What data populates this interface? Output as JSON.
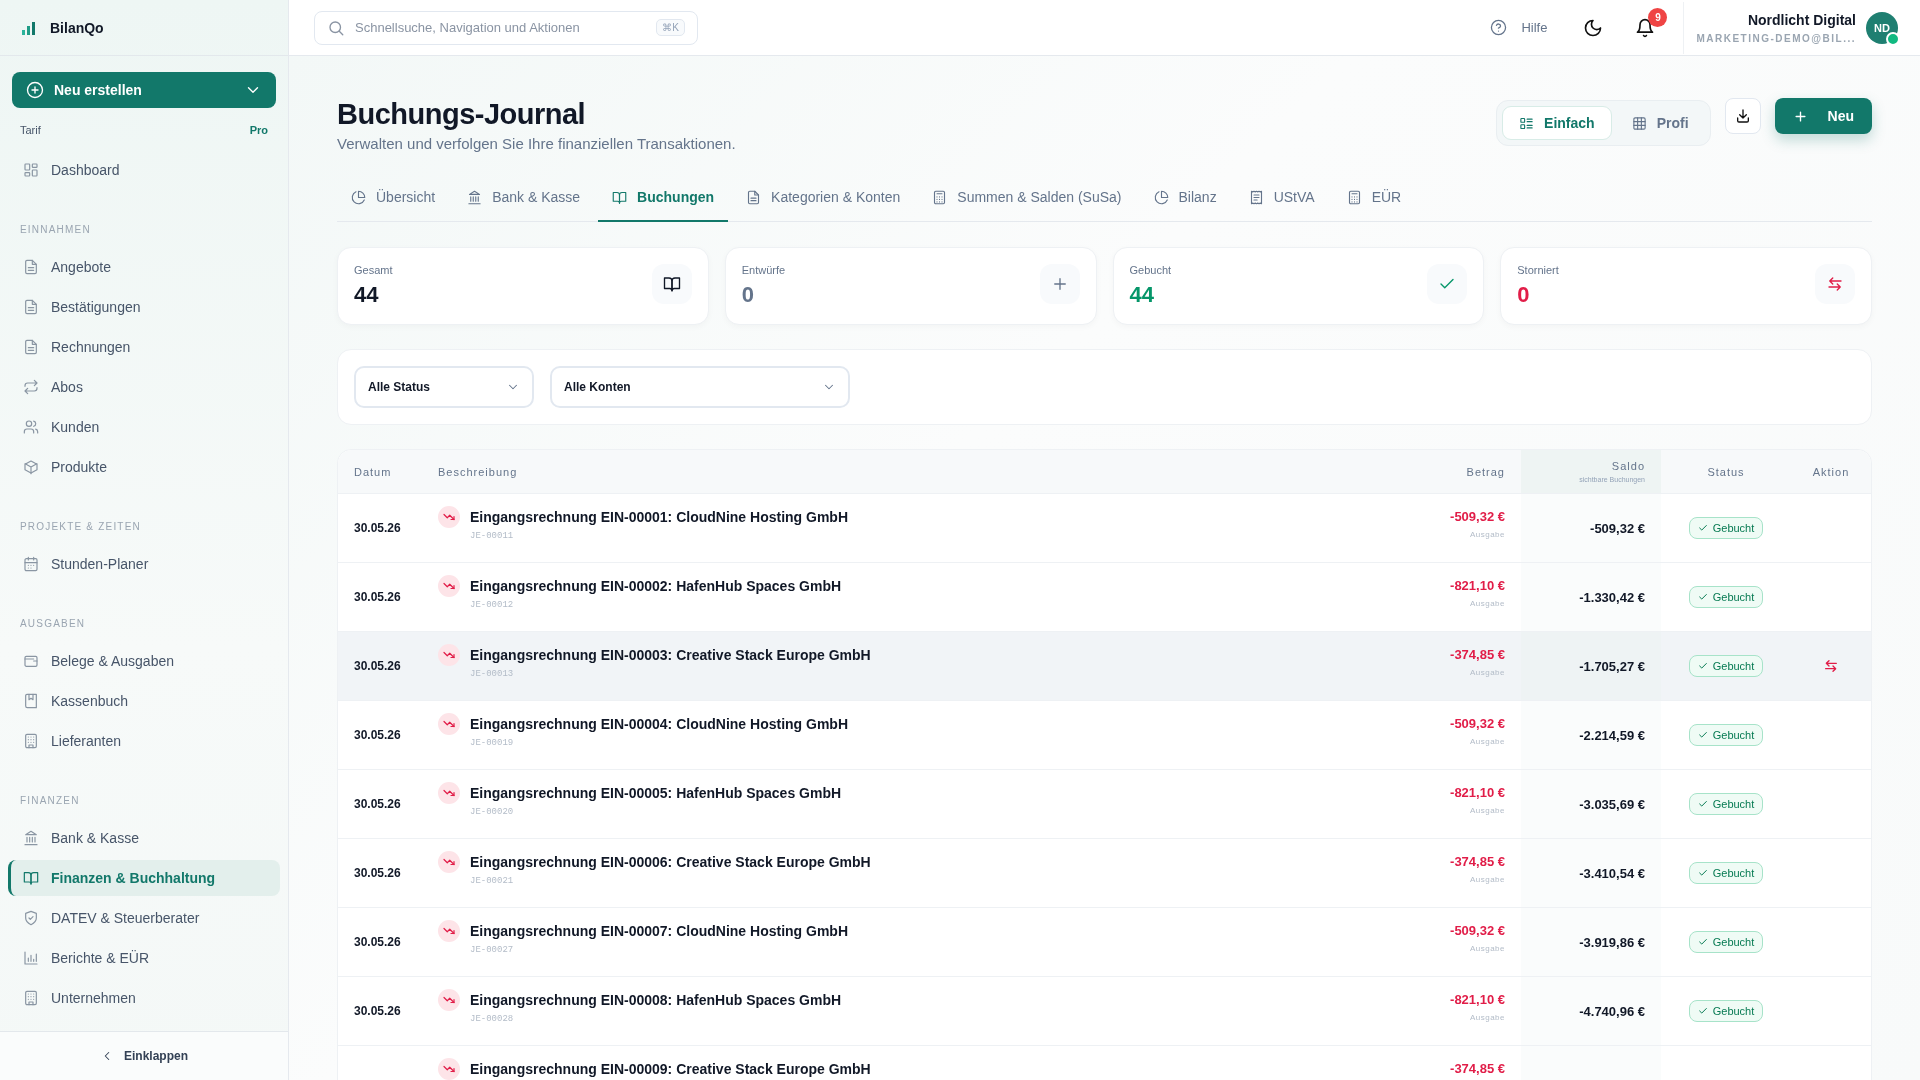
{
  "sidebar": {
    "logo": "BilanQo",
    "create_button": "Neu erstellen",
    "plan_label": "Tarif",
    "plan_value": "Pro",
    "sections": [
      {
        "items": [
          {
            "label": "Dashboard",
            "selected": false
          }
        ]
      },
      {
        "heading": "EINNAHMEN",
        "items": [
          {
            "label": "Angebote",
            "selected": false
          },
          {
            "label": "Bestätigungen",
            "selected": false
          },
          {
            "label": "Rechnungen",
            "selected": false
          },
          {
            "label": "Abos",
            "selected": false
          },
          {
            "label": "Kunden",
            "selected": false
          },
          {
            "label": "Produkte",
            "selected": false
          }
        ]
      },
      {
        "heading": "PROJEKTE & ZEITEN",
        "items": [
          {
            "label": "Stunden-Planer",
            "selected": false
          }
        ]
      },
      {
        "heading": "AUSGABEN",
        "items": [
          {
            "label": "Belege & Ausgaben",
            "selected": false
          },
          {
            "label": "Kassenbuch",
            "selected": false
          },
          {
            "label": "Lieferanten",
            "selected": false
          }
        ]
      },
      {
        "heading": "FINANZEN",
        "items": [
          {
            "label": "Bank & Kasse",
            "selected": false
          },
          {
            "label": "Finanzen & Buchhaltung",
            "selected": true
          },
          {
            "label": "DATEV & Steuerberater",
            "selected": false
          },
          {
            "label": "Berichte & EÜR",
            "selected": false
          },
          {
            "label": "Unternehmen",
            "selected": false
          }
        ]
      }
    ],
    "collapse": "Einklappen"
  },
  "header": {
    "search": {
      "placeholder": "Schnellsuche, Navigation und Aktionen",
      "shortcut": "⌘K"
    },
    "help": "Hilfe",
    "notifications": "9",
    "user": {
      "name": "Nordlicht Digital",
      "email": "MARKETING-DEMO@BIL...",
      "initials": "ND",
      "online": true
    }
  },
  "page": {
    "title": "Buchungs-Journal",
    "subtitle": "Verwalten und verfolgen Sie Ihre finanziellen Transaktionen.",
    "view_toggle": [
      {
        "label": "Einfach",
        "selected": true
      },
      {
        "label": "Profi",
        "selected": false
      }
    ],
    "new_button": "Neu"
  },
  "tabs": [
    {
      "label": "Übersicht",
      "selected": false
    },
    {
      "label": "Bank & Kasse",
      "selected": false
    },
    {
      "label": "Buchungen",
      "selected": true
    },
    {
      "label": "Kategorien & Konten",
      "selected": false
    },
    {
      "label": "Summen & Salden (SuSa)",
      "selected": false
    },
    {
      "label": "Bilanz",
      "selected": false
    },
    {
      "label": "UStVA",
      "selected": false
    },
    {
      "label": "EÜR",
      "selected": false
    }
  ],
  "stats": [
    {
      "label": "Gesamt",
      "value": "44",
      "color": "#111827"
    },
    {
      "label": "Entwürfe",
      "value": "0",
      "color": "#64748b"
    },
    {
      "label": "Gebucht",
      "value": "44",
      "color": "#059669"
    },
    {
      "label": "Storniert",
      "value": "0",
      "color": "#e11d48"
    }
  ],
  "filters": [
    "Alle Status",
    "Alle Konten"
  ],
  "table": {
    "columns": {
      "date": "Datum",
      "description": "Beschreibung",
      "amount": "Betrag",
      "balance": "Saldo",
      "balance_note": "sichtbare Buchungen",
      "status": "Status",
      "action": "Aktion"
    },
    "rows": [
      {
        "date": "30.05.26",
        "description": "Eingangsrechnung EIN-00001: CloudNine Hosting GmbH",
        "ref": "JE-00011",
        "amount": "-509,32 €",
        "type": "Ausgabe",
        "kind": "expense",
        "balance": "-509,32 €",
        "status": "Gebucht",
        "hovered": false
      },
      {
        "date": "30.05.26",
        "description": "Eingangsrechnung EIN-00002: HafenHub Spaces GmbH",
        "ref": "JE-00012",
        "amount": "-821,10 €",
        "type": "Ausgabe",
        "kind": "expense",
        "balance": "-1.330,42 €",
        "status": "Gebucht",
        "hovered": false
      },
      {
        "date": "30.05.26",
        "description": "Eingangsrechnung EIN-00003: Creative Stack Europe GmbH",
        "ref": "JE-00013",
        "amount": "-374,85 €",
        "type": "Ausgabe",
        "kind": "expense",
        "balance": "-1.705,27 €",
        "status": "Gebucht",
        "hovered": true
      },
      {
        "date": "30.05.26",
        "description": "Eingangsrechnung EIN-00004: CloudNine Hosting GmbH",
        "ref": "JE-00019",
        "amount": "-509,32 €",
        "type": "Ausgabe",
        "kind": "expense",
        "balance": "-2.214,59 €",
        "status": "Gebucht",
        "hovered": false
      },
      {
        "date": "30.05.26",
        "description": "Eingangsrechnung EIN-00005: HafenHub Spaces GmbH",
        "ref": "JE-00020",
        "amount": "-821,10 €",
        "type": "Ausgabe",
        "kind": "expense",
        "balance": "-3.035,69 €",
        "status": "Gebucht",
        "hovered": false
      },
      {
        "date": "30.05.26",
        "description": "Eingangsrechnung EIN-00006: Creative Stack Europe GmbH",
        "ref": "JE-00021",
        "amount": "-374,85 €",
        "type": "Ausgabe",
        "kind": "expense",
        "balance": "-3.410,54 €",
        "status": "Gebucht",
        "hovered": false
      },
      {
        "date": "30.05.26",
        "description": "Eingangsrechnung EIN-00007: CloudNine Hosting GmbH",
        "ref": "JE-00027",
        "amount": "-509,32 €",
        "type": "Ausgabe",
        "kind": "expense",
        "balance": "-3.919,86 €",
        "status": "Gebucht",
        "hovered": false
      },
      {
        "date": "30.05.26",
        "description": "Eingangsrechnung EIN-00008: HafenHub Spaces GmbH",
        "ref": "JE-00028",
        "amount": "-821,10 €",
        "type": "Ausgabe",
        "kind": "expense",
        "balance": "-4.740,96 €",
        "status": "Gebucht",
        "hovered": false
      },
      {
        "description": "Eingangsrechnung EIN-00009: Creative Stack Europe GmbH",
        "amount": "-374,85 €",
        "kind": "expense",
        "hovered": false
      }
    ]
  }
}
